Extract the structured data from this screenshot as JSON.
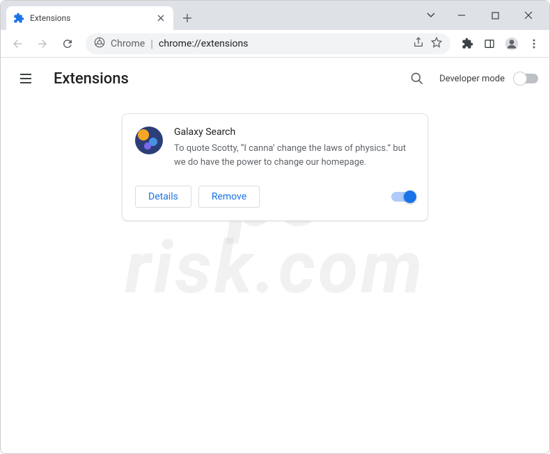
{
  "tab": {
    "title": "Extensions"
  },
  "omnibox": {
    "prefix": "Chrome",
    "url": "chrome://extensions"
  },
  "header": {
    "title": "Extensions",
    "dev_mode_label": "Developer mode"
  },
  "extension": {
    "name": "Galaxy Search",
    "description": "To quote Scotty, “I canna’ change the laws of physics.” but we do have the power to change our homepage.",
    "details_btn": "Details",
    "remove_btn": "Remove",
    "enabled": true
  },
  "dev_mode_enabled": false,
  "watermark": {
    "line1": "pc",
    "line2": "risk.com"
  }
}
